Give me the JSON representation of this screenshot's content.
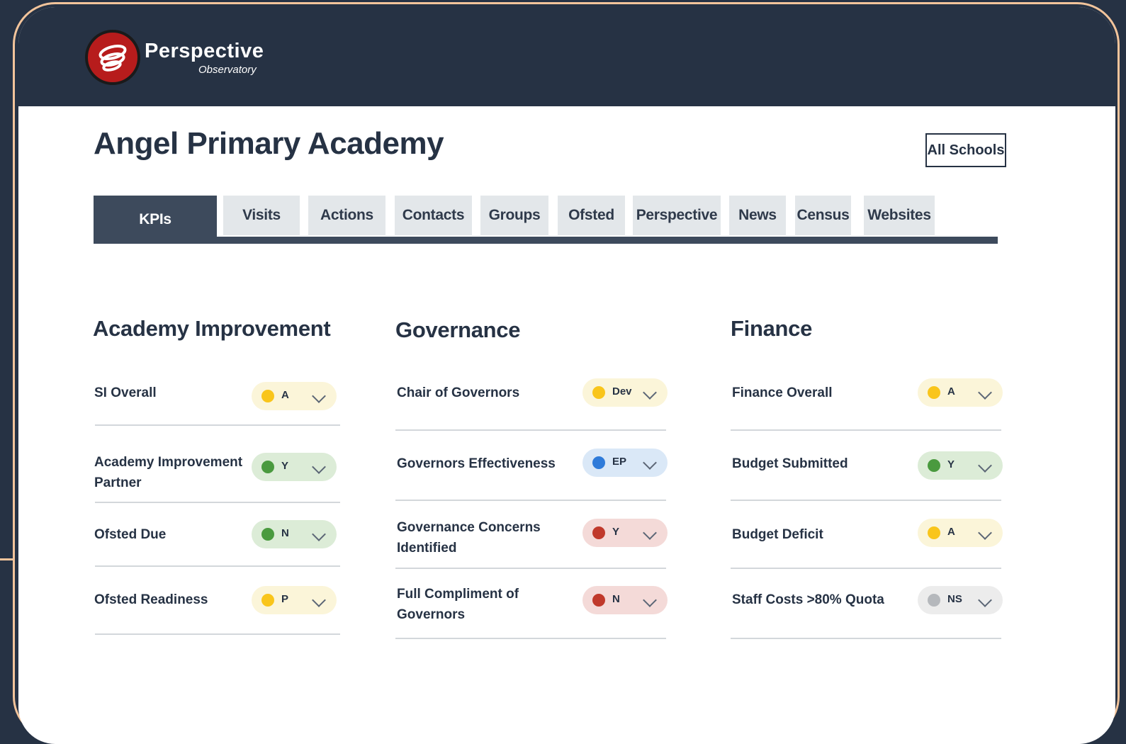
{
  "brand": {
    "name": "Perspective",
    "sub": "Observatory"
  },
  "page": {
    "title": "Angel Primary Academy",
    "all_schools_label": "All Schools"
  },
  "tabs": [
    {
      "label": "KPIs",
      "active": true
    },
    {
      "label": "Visits"
    },
    {
      "label": "Actions"
    },
    {
      "label": "Contacts"
    },
    {
      "label": "Groups"
    },
    {
      "label": "Ofsted"
    },
    {
      "label": "Perspective"
    },
    {
      "label": "News"
    },
    {
      "label": "Census"
    },
    {
      "label": "Websites"
    }
  ],
  "sections": [
    {
      "title": "Academy Improvement",
      "items": [
        {
          "label": "SI Overall",
          "status": "A",
          "color": "#f9c51b",
          "bg": "#fbf5d9"
        },
        {
          "label": "Academy Improvement Partner",
          "status": "Y",
          "color": "#4a9a3f",
          "bg": "#dcecd7"
        },
        {
          "label": "Ofsted Due",
          "status": "N",
          "color": "#4a9a3f",
          "bg": "#dcecd7"
        },
        {
          "label": "Ofsted Readiness",
          "status": "P",
          "color": "#f9c51b",
          "bg": "#fbf5d9"
        }
      ]
    },
    {
      "title": "Governance",
      "items": [
        {
          "label": "Chair of Governors",
          "status": "Dev",
          "color": "#f9c51b",
          "bg": "#fbf5d9"
        },
        {
          "label": "Governors Effectiveness",
          "status": "EP",
          "color": "#2f7bd9",
          "bg": "#dae8f7"
        },
        {
          "label": "Governance Concerns Identified",
          "status": "Y",
          "color": "#c0392b",
          "bg": "#f4dad8"
        },
        {
          "label": "Full Compliment of Governors",
          "status": "N",
          "color": "#c0392b",
          "bg": "#f4dad8"
        }
      ]
    },
    {
      "title": "Finance",
      "items": [
        {
          "label": "Finance Overall",
          "status": "A",
          "color": "#f9c51b",
          "bg": "#fbf5d9"
        },
        {
          "label": "Budget Submitted",
          "status": "Y",
          "color": "#4a9a3f",
          "bg": "#dcecd7"
        },
        {
          "label": "Budget Deficit",
          "status": "A",
          "color": "#f9c51b",
          "bg": "#fbf5d9"
        },
        {
          "label": "Staff Costs >80% Quota",
          "status": "NS",
          "color": "#b5b8bc",
          "bg": "#ececec"
        }
      ]
    }
  ]
}
